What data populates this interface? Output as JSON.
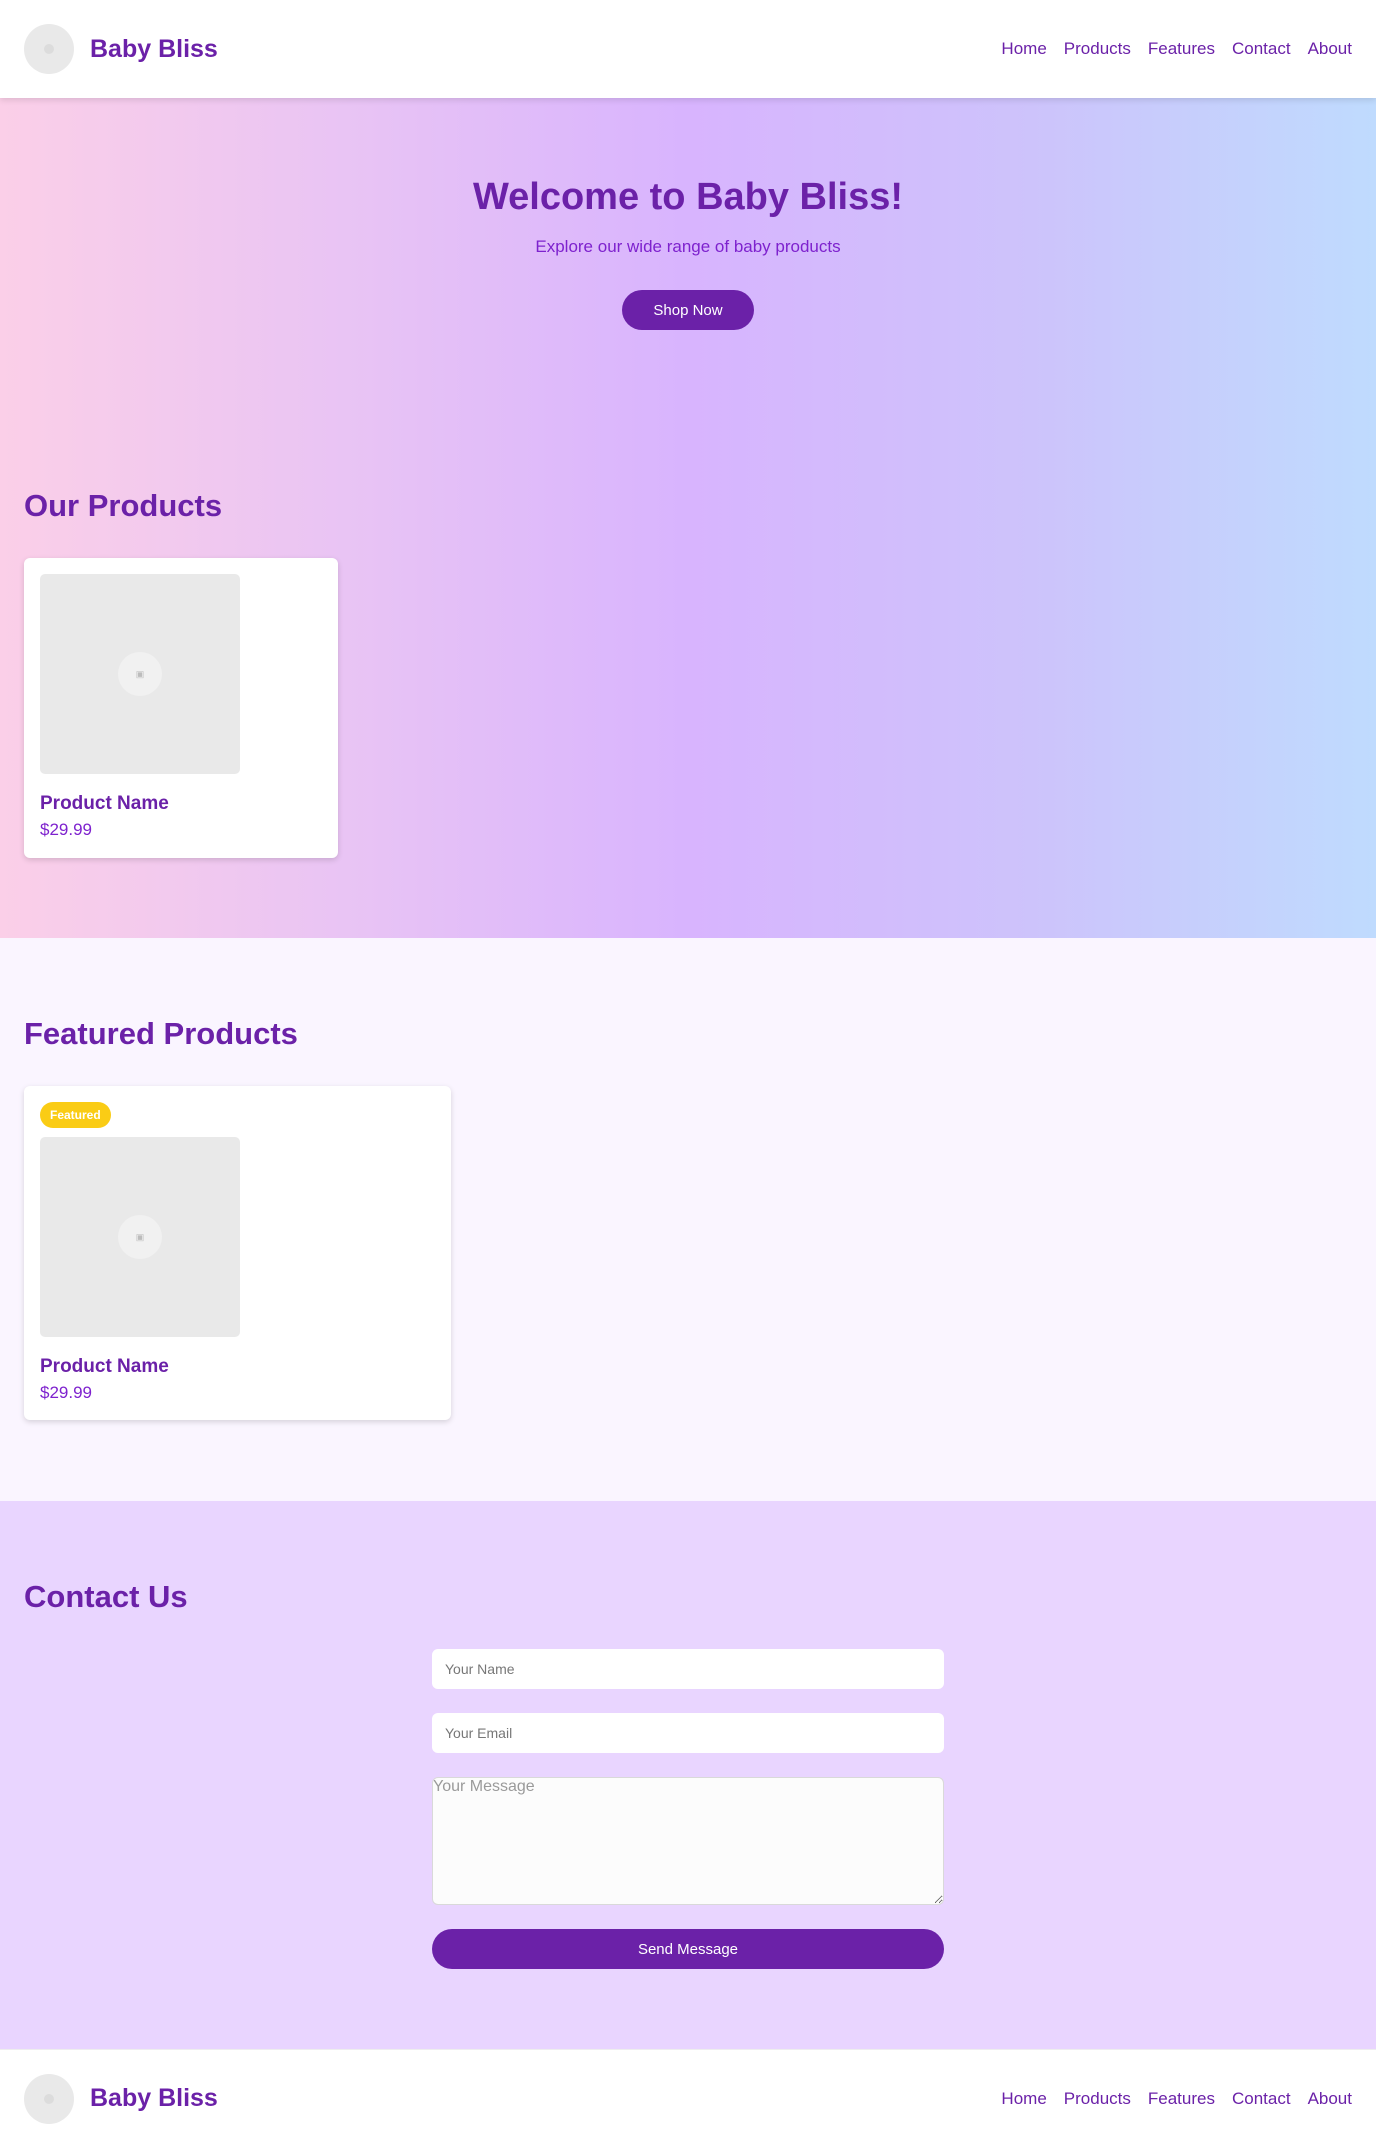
{
  "header": {
    "brand": "Baby Bliss",
    "nav": [
      "Home",
      "Products",
      "Features",
      "Contact",
      "About"
    ]
  },
  "hero": {
    "title": "Welcome to Baby Bliss!",
    "subtitle": "Explore our wide range of baby products",
    "cta_label": "Shop Now"
  },
  "products": {
    "title": "Our Products",
    "items": [
      {
        "name": "Product Name",
        "price": "$29.99"
      }
    ]
  },
  "featured": {
    "title": "Featured Products",
    "items": [
      {
        "badge": "Featured",
        "name": "Product Name",
        "price": "$29.99"
      }
    ]
  },
  "contact": {
    "title": "Contact Us",
    "name_placeholder": "Your Name",
    "email_placeholder": "Your Email",
    "message_placeholder": "Your Message",
    "submit_label": "Send Message"
  },
  "footer": {
    "brand": "Baby Bliss",
    "nav": [
      "Home",
      "Products",
      "Features",
      "Contact",
      "About"
    ]
  },
  "colors": {
    "primary": "#6b21a8",
    "badge": "#facc15",
    "featured_bg": "#faf5ff",
    "contact_bg": "#e9d5ff"
  },
  "icons": {
    "logo": "baby-logo-icon",
    "product_image": "image-placeholder-icon"
  }
}
